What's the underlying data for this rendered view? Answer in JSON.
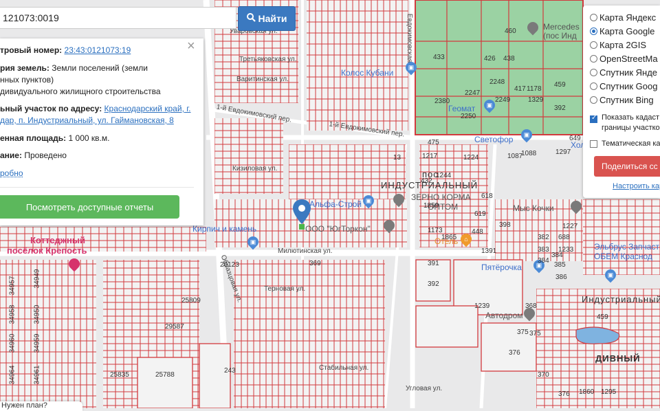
{
  "search": {
    "value": "121073:0019",
    "button_label": "Найти"
  },
  "info": {
    "cad_label": "тровый номер:",
    "cad_value": "23:43:0121073:19",
    "category_label": "рия земель:",
    "category_value_1": "Земли поселений (земли",
    "category_value_2": "нных пунктов)",
    "use": "дивидуального жилищного строительства",
    "address_label": "ьный участок по адресу:",
    "address_value_1": "Краснодарский край, г.",
    "address_value_2": "дар, п. Индустриальный, ул. Гаймановская, 8",
    "area_label": "енная площадь:",
    "area_value": "1 000 кв.м.",
    "survey_label": "ание:",
    "survey_value": "Проведено",
    "more_link": "робно",
    "reports_button": "Посмотреть доступные отчеты"
  },
  "layers": {
    "options": [
      {
        "label": "Карта Яндекс",
        "selected": false
      },
      {
        "label": "Карта Google",
        "selected": true
      },
      {
        "label": "Карта 2GIS",
        "selected": false
      },
      {
        "label": "OpenStreetMa",
        "selected": false
      },
      {
        "label": "Спутник Янде",
        "selected": false
      },
      {
        "label": "Спутник Goog",
        "selected": false
      },
      {
        "label": "Спутник Bing",
        "selected": false
      }
    ],
    "show_cadastral_1": "Показать кадаст",
    "show_cadastral_2": "границы участко",
    "thematic": "Тематическая ка",
    "share_button": "Поделиться сс",
    "setup_link": "Настроить кар"
  },
  "bottom_tip": "Нужен план?",
  "map": {
    "streets": {
      "uvarovskaya": "Уваровская ул.",
      "tretyakovskaya": "Третьяковская ул.",
      "varitinskaya": "Варитинская ул.",
      "evdokimovsky1": "1-й Евдокимовский пер.",
      "evdokimovsky1b": "1-й Евдокимовский пер.",
      "evdokimovskaya": "Евдокимовская",
      "kizilovaya": "Кизиловая ул.",
      "milyutinskaya": "Милютинская ул.",
      "ternovaya": "Терновая ул.",
      "stabilnaya": "Стабильная ул.",
      "obraztsovaya": "Образцовая ул.",
      "uglovaya": "Угловая ул."
    },
    "districts": {
      "industrial": "ИНДУСТРИАЛЬНЫЙ",
      "industrial_right": "Индустриальный",
      "divny": "ДИВНЫЙ",
      "pos": "пос"
    },
    "pois": {
      "mercedes_1": "Mercedes",
      "mercedes_2": "(пос Инд",
      "kolos": "Колос Кубани",
      "geomat": "Геомат",
      "svetofor": "Светофор",
      "zerno_1": "ЗЕРНО КОРМА",
      "zerno_2": "ОПТОМ",
      "alfa": "Альфа-Строй",
      "kirpich": "Кирпич и камень",
      "ooo": "ООО \"ЮгТоркон\"",
      "kottedzh_1": "Коттеджный",
      "kottedzh_2": "посёлок Крепость",
      "hotel": "Отель",
      "pyaterochka": "Пятёрочка",
      "avtodrom": "Автодром",
      "moy": "Мыс Кочки",
      "elbrus_1": "Эльбрус Запчаст",
      "elbrus_2": "ОБЕМ Краснод",
      "hol": "Хол"
    },
    "lot_numbers": [
      "460",
      "433",
      "426",
      "438",
      "1178",
      "459",
      "2380",
      "2247",
      "2248",
      "417",
      "1329",
      "392",
      "2250",
      "2249",
      "475",
      "649",
      "1217",
      "1224",
      "1087",
      "1088",
      "1297",
      "432",
      "1244",
      "1859",
      "618",
      "619",
      "1173",
      "1865",
      "448",
      "398",
      "1227",
      "382",
      "688",
      "383",
      "1233",
      "384",
      "384",
      "385",
      "386",
      "391",
      "392",
      "1391",
      "375",
      "376",
      "1239",
      "368",
      "375",
      "370",
      "459",
      "376",
      "369",
      "20123",
      "34957",
      "34949",
      "34958",
      "34950",
      "34960",
      "34959",
      "34964",
      "34961",
      "25809",
      "29587",
      "25788",
      "25835",
      "243",
      "1860",
      "1295",
      "13"
    ]
  },
  "colors": {
    "parcel_line": "#d2393d",
    "road": "#ffffff",
    "background": "#e9e9ea",
    "green_parcel": "#9bd2a3",
    "primary": "#3b79c0",
    "success": "#5cb85c",
    "danger": "#d9534f"
  },
  "icons": [
    "search-icon",
    "close-icon",
    "map-marker-icon",
    "shopping-bag-icon",
    "car-icon",
    "hotel-icon"
  ]
}
